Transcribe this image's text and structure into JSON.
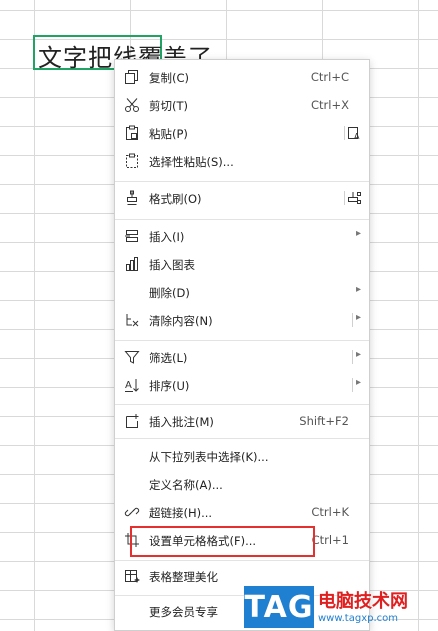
{
  "cell": {
    "text": "文字把线覆盖了"
  },
  "menu": {
    "items": [
      {
        "id": "copy",
        "label": "复制(C)",
        "shortcut": "Ctrl+C",
        "icon": "copy-icon"
      },
      {
        "id": "cut",
        "label": "剪切(T)",
        "shortcut": "Ctrl+X",
        "icon": "scissors-icon"
      },
      {
        "id": "paste",
        "label": "粘贴(P)",
        "icon": "paste-icon"
      },
      {
        "id": "paste-special",
        "label": "选择性粘贴(S)...",
        "icon": "paste-special-icon"
      },
      {
        "id": "format-painter",
        "label": "格式刷(O)",
        "icon": "format-painter-icon"
      },
      {
        "id": "insert",
        "label": "插入(I)",
        "icon": "insert-icon"
      },
      {
        "id": "insert-chart",
        "label": "插入图表",
        "icon": "chart-icon"
      },
      {
        "id": "delete",
        "label": "删除(D)"
      },
      {
        "id": "clear",
        "label": "清除内容(N)",
        "icon": "eraser-icon"
      },
      {
        "id": "filter",
        "label": "筛选(L)",
        "icon": "filter-icon"
      },
      {
        "id": "sort",
        "label": "排序(U)",
        "icon": "sort-icon"
      },
      {
        "id": "insert-comment",
        "label": "插入批注(M)",
        "shortcut": "Shift+F2",
        "icon": "comment-icon"
      },
      {
        "id": "dropdown-pick",
        "label": "从下拉列表中选择(K)..."
      },
      {
        "id": "define-name",
        "label": "定义名称(A)..."
      },
      {
        "id": "hyperlink",
        "label": "超链接(H)...",
        "shortcut": "Ctrl+K",
        "icon": "link-icon"
      },
      {
        "id": "format-cells",
        "label": "设置单元格格式(F)...",
        "shortcut": "Ctrl+1",
        "icon": "crop-icon"
      },
      {
        "id": "table-beautify",
        "label": "表格整理美化",
        "icon": "table-magic-icon"
      },
      {
        "id": "vip",
        "label": "更多会员专享"
      }
    ]
  },
  "watermark": {
    "badge": "TAG",
    "title": "电脑技术网",
    "url": "www.tagxp.com"
  },
  "colors": {
    "selection": "#21a366",
    "highlight": "#e53030",
    "watermark_blue": "#1f7fd0",
    "watermark_red": "#e02020"
  }
}
